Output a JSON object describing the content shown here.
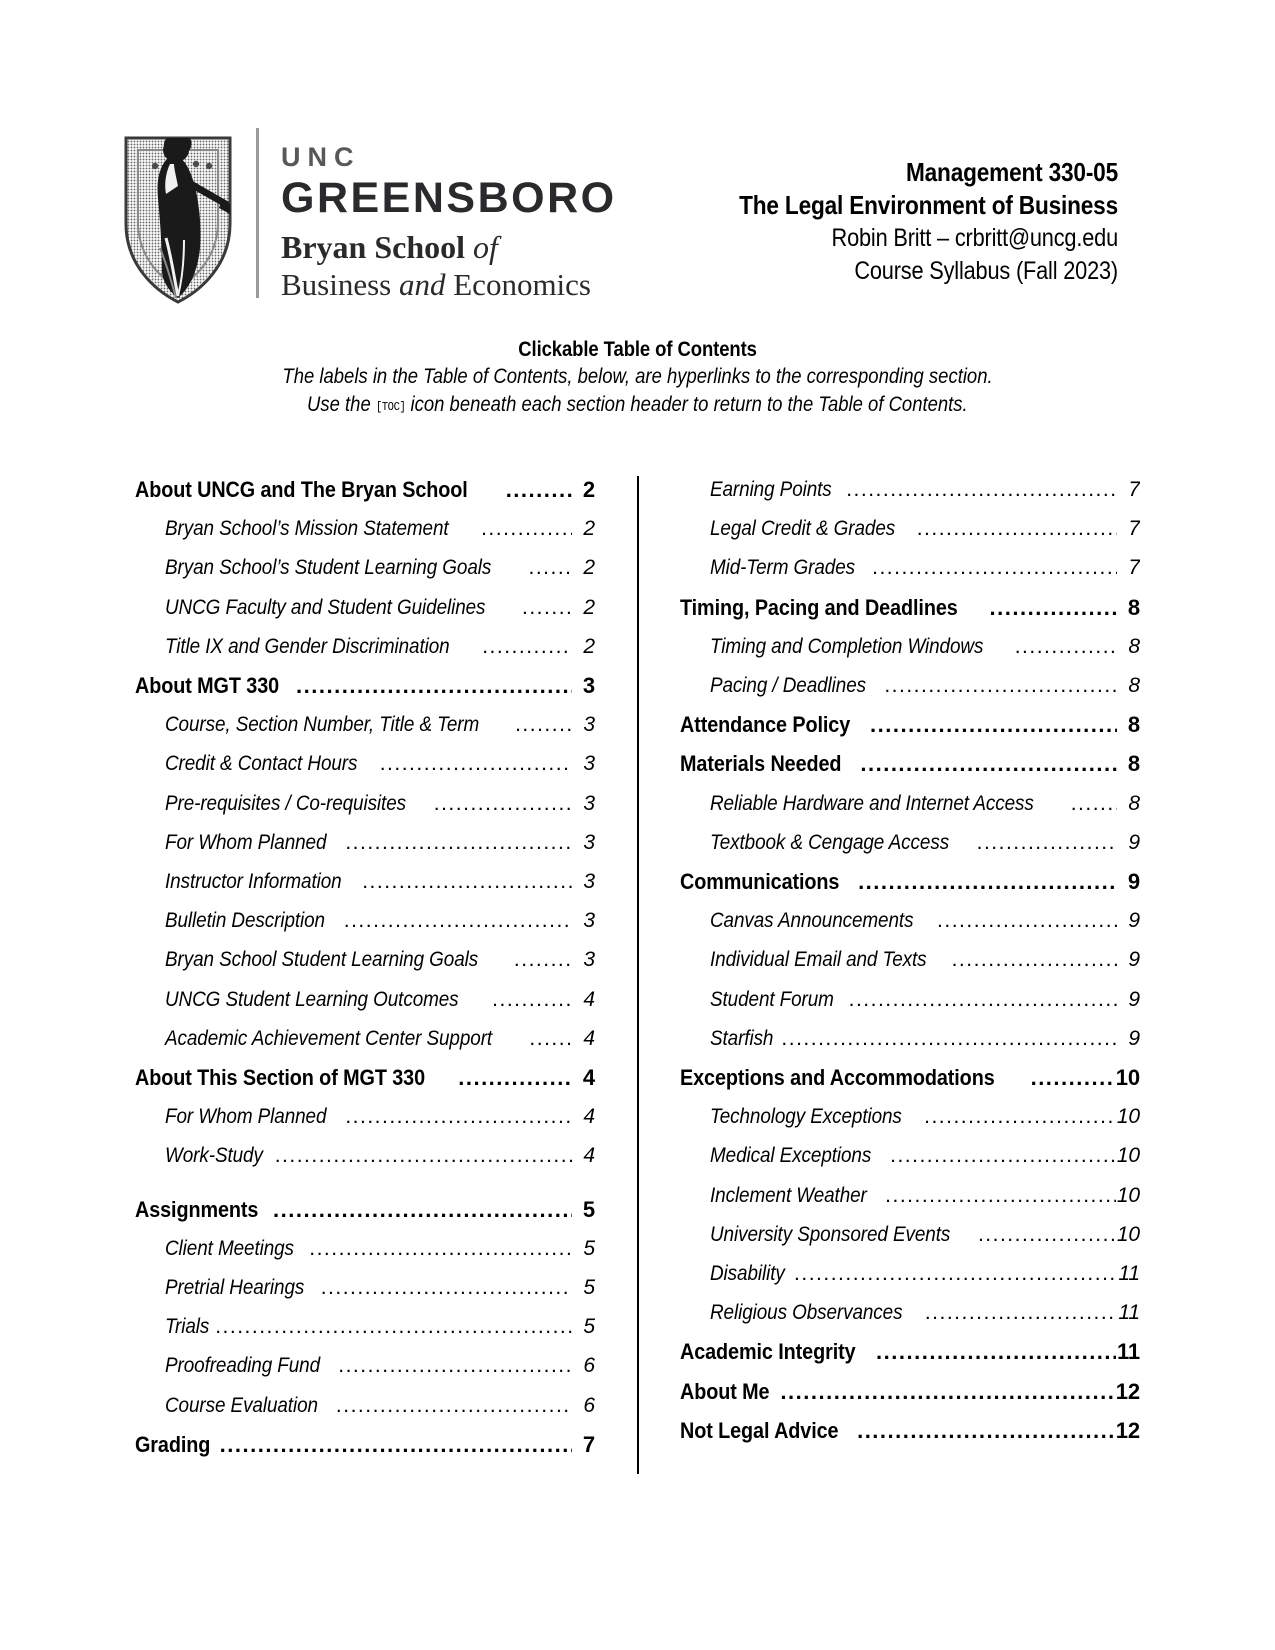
{
  "document": {
    "logo": {
      "shield_icon": "uncg-shield-icon",
      "unc": "UNC",
      "greensboro": "GREENSBORO",
      "bryan_school": "Bryan School",
      "bryan_school_of": "of",
      "business": "Business",
      "and": "and",
      "economics": "Economics"
    },
    "course_header": {
      "course_number": "Management 330-05",
      "course_title": "The Legal Environment of Business",
      "instructor": "Robin Britt – crbritt@uncg.edu",
      "syllabus_term": "Course Syllabus (Fall 2023)"
    },
    "toc_intro": {
      "title": "Clickable Table of Contents",
      "line1": "The labels in the Table of Contents, below, are hyperlinks to the corresponding section.",
      "line2_before": "Use the ",
      "toc_icon_label": "[TOC]",
      "line2_after": " icon beneath each section header to return to the Table of Contents."
    },
    "toc": {
      "left_column": [
        {
          "level": 1,
          "label": "About UNCG and The Bryan School",
          "page": "2"
        },
        {
          "level": 2,
          "label": "Bryan School’s Mission Statement",
          "page": "2"
        },
        {
          "level": 2,
          "label": "Bryan School’s Student Learning Goals",
          "page": "2"
        },
        {
          "level": 2,
          "label": "UNCG Faculty and Student Guidelines",
          "page": "2"
        },
        {
          "level": 2,
          "label": "Title IX and Gender Discrimination",
          "page": "2"
        },
        {
          "level": 1,
          "label": "About MGT 330",
          "page": "3"
        },
        {
          "level": 2,
          "label": "Course, Section Number, Title & Term",
          "page": "3"
        },
        {
          "level": 2,
          "label": "Credit & Contact Hours",
          "page": "3"
        },
        {
          "level": 2,
          "label": "Pre-requisites / Co-requisites",
          "page": "3"
        },
        {
          "level": 2,
          "label": "For Whom Planned",
          "page": "3"
        },
        {
          "level": 2,
          "label": "Instructor Information",
          "page": "3"
        },
        {
          "level": 2,
          "label": "Bulletin Description",
          "page": "3"
        },
        {
          "level": 2,
          "label": "Bryan School Student Learning Goals",
          "page": "3"
        },
        {
          "level": 2,
          "label": "UNCG Student Learning Outcomes",
          "page": "4"
        },
        {
          "level": 2,
          "label": "Academic Achievement Center Support",
          "page": "4"
        },
        {
          "level": 1,
          "label": "About This Section of MGT 330",
          "page": "4"
        },
        {
          "level": 2,
          "label": "For Whom Planned",
          "page": "4"
        },
        {
          "level": 2,
          "label": "Work-Study",
          "page": "4"
        },
        {
          "level": 1,
          "label": "Assignments",
          "page": "5"
        },
        {
          "level": 2,
          "label": "Client Meetings",
          "page": "5"
        },
        {
          "level": 2,
          "label": "Pretrial Hearings",
          "page": "5"
        },
        {
          "level": 2,
          "label": "Trials",
          "page": "5"
        },
        {
          "level": 2,
          "label": "Proofreading Fund",
          "page": "6"
        },
        {
          "level": 2,
          "label": "Course Evaluation",
          "page": "6"
        },
        {
          "level": 1,
          "label": "Grading",
          "page": "7"
        }
      ],
      "right_column": [
        {
          "level": 2,
          "label": "Earning Points",
          "page": "7"
        },
        {
          "level": 2,
          "label": "Legal Credit & Grades",
          "page": "7"
        },
        {
          "level": 2,
          "label": "Mid-Term Grades",
          "page": "7"
        },
        {
          "level": 1,
          "label": "Timing, Pacing and Deadlines",
          "page": "8"
        },
        {
          "level": 2,
          "label": "Timing and Completion Windows",
          "page": "8"
        },
        {
          "level": 2,
          "label": "Pacing / Deadlines",
          "page": "8"
        },
        {
          "level": 1,
          "label": "Attendance Policy",
          "page": "8"
        },
        {
          "level": 1,
          "label": "Materials Needed",
          "page": "8"
        },
        {
          "level": 2,
          "label": "Reliable Hardware and Internet Access",
          "page": "8"
        },
        {
          "level": 2,
          "label": "Textbook & Cengage Access",
          "page": "9"
        },
        {
          "level": 1,
          "label": "Communications",
          "page": "9"
        },
        {
          "level": 2,
          "label": "Canvas Announcements",
          "page": "9"
        },
        {
          "level": 2,
          "label": "Individual Email and Texts",
          "page": "9"
        },
        {
          "level": 2,
          "label": "Student Forum",
          "page": "9"
        },
        {
          "level": 2,
          "label": "Starfish",
          "page": "9"
        },
        {
          "level": 1,
          "label": "Exceptions and Accommodations",
          "page": "10"
        },
        {
          "level": 2,
          "label": "Technology Exceptions",
          "page": "10"
        },
        {
          "level": 2,
          "label": "Medical Exceptions",
          "page": "10"
        },
        {
          "level": 2,
          "label": "Inclement Weather",
          "page": "10"
        },
        {
          "level": 2,
          "label": "University Sponsored Events",
          "page": "10"
        },
        {
          "level": 2,
          "label": "Disability",
          "page": "11"
        },
        {
          "level": 2,
          "label": "Religious Observances",
          "page": "11"
        },
        {
          "level": 1,
          "label": "Academic Integrity",
          "page": "11"
        },
        {
          "level": 1,
          "label": "About Me",
          "page": "12"
        },
        {
          "level": 1,
          "label": "Not Legal Advice",
          "page": "12"
        }
      ]
    }
  }
}
